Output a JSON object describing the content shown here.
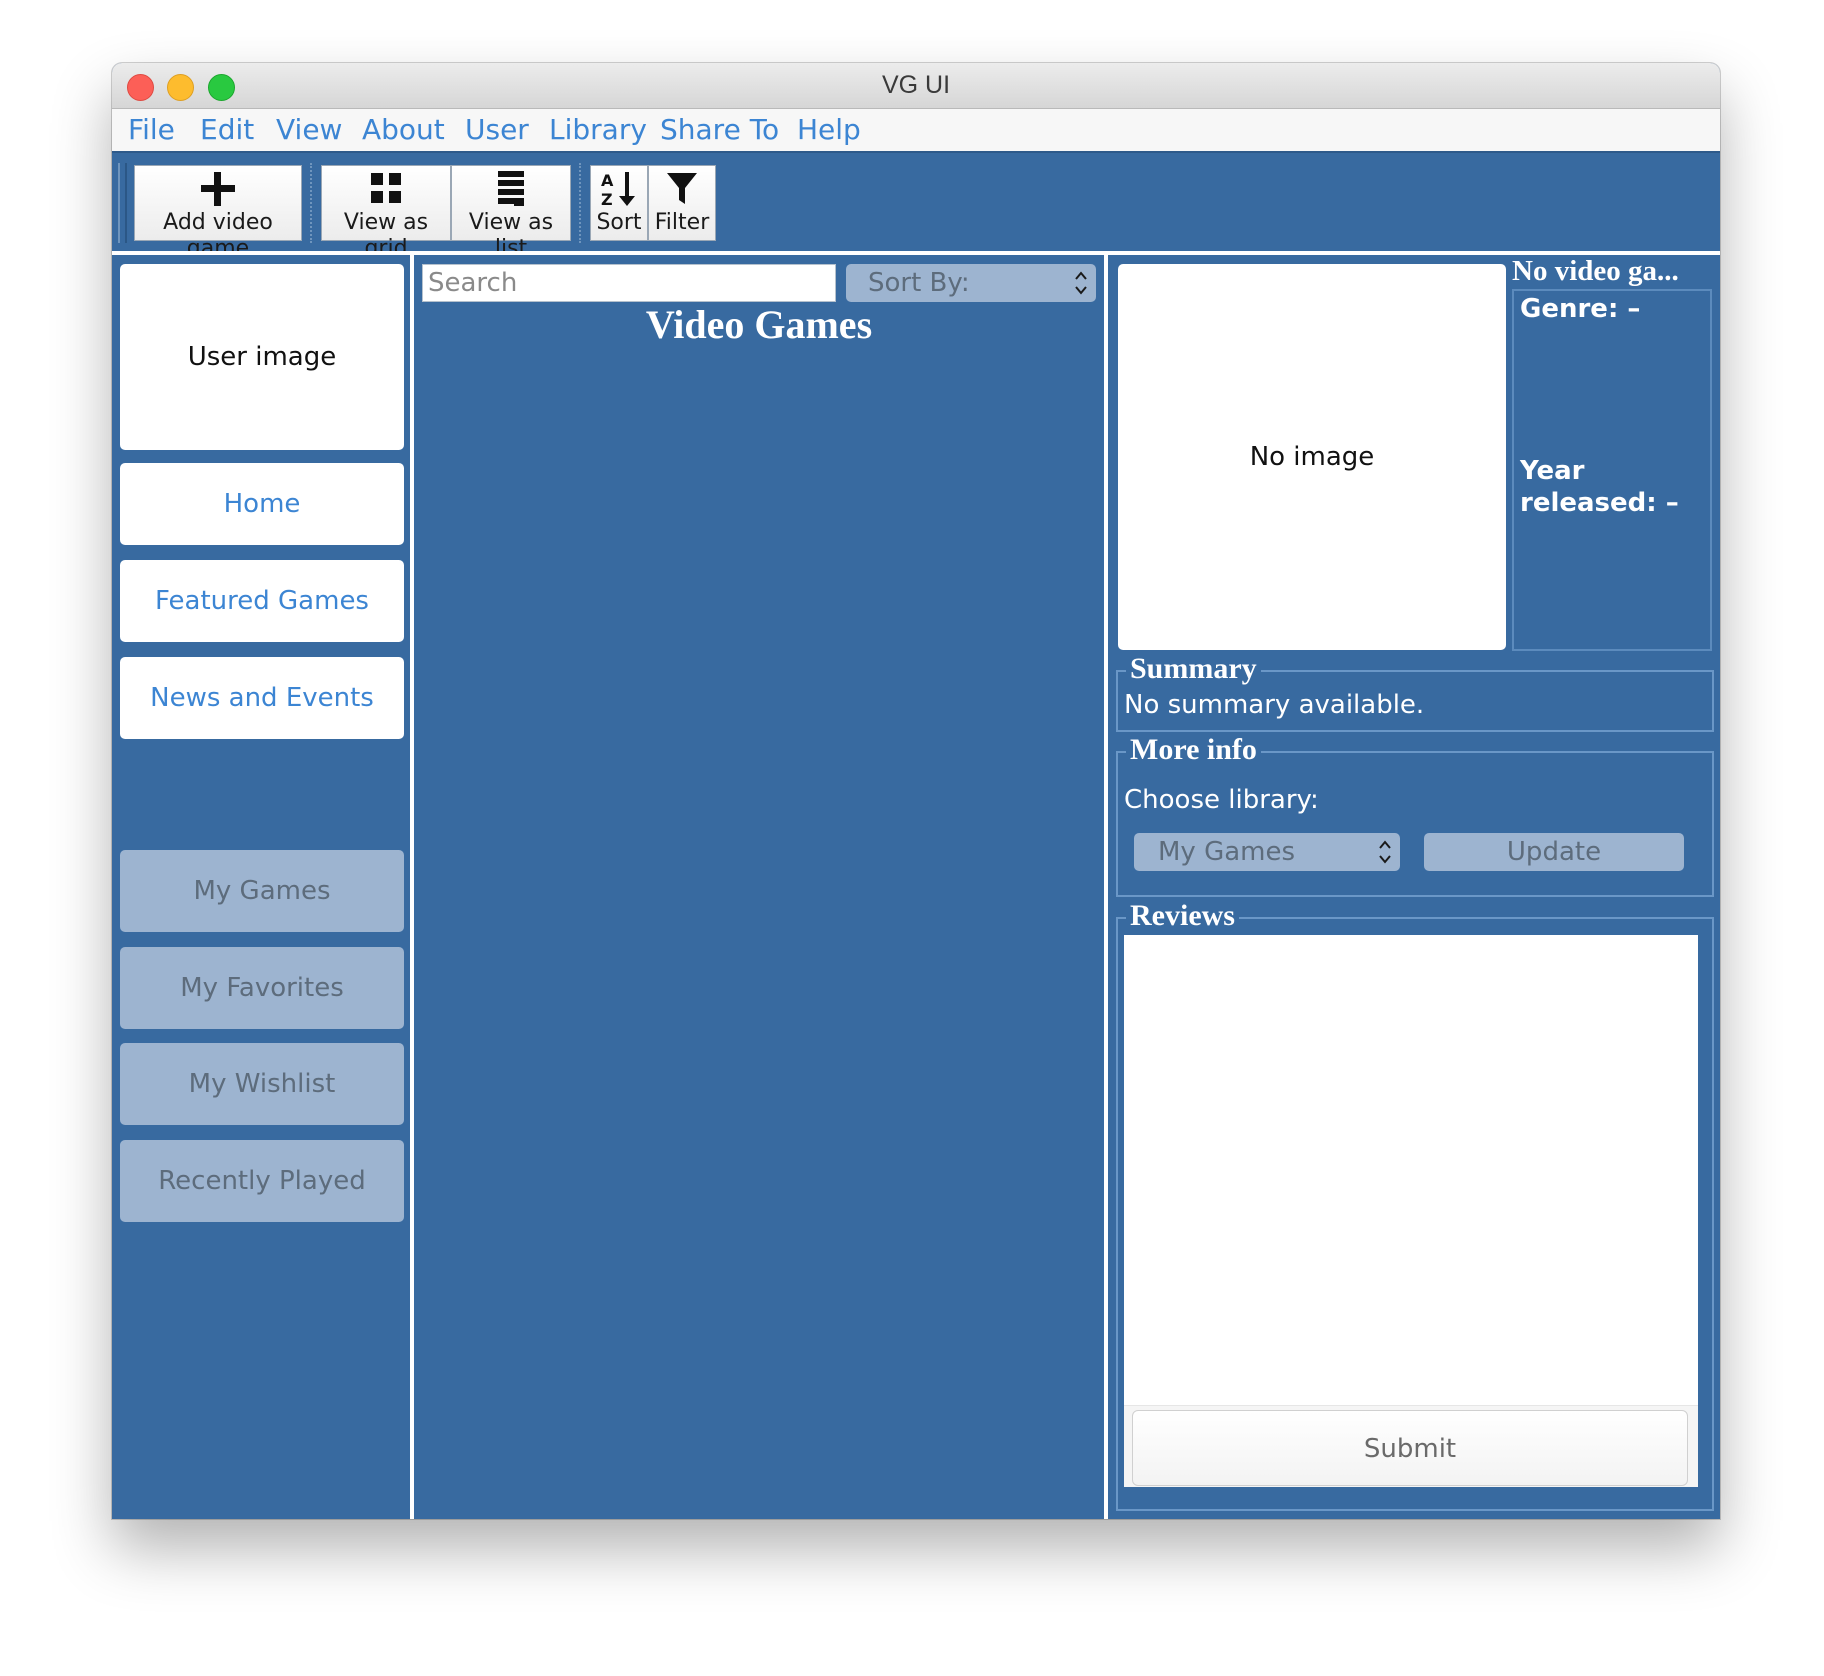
{
  "window": {
    "title": "VG UI"
  },
  "menu": [
    "File",
    "Edit",
    "View",
    "About",
    "User",
    "Library",
    "Share To",
    "Help"
  ],
  "toolbar": {
    "add_label": "Add video game",
    "grid_label": "View as grid",
    "list_label": "View as list",
    "sort_label": "Sort",
    "filter_label": "Filter"
  },
  "sidebar": {
    "user_image": "User image",
    "nav": [
      "Home",
      "Featured Games",
      "News and Events"
    ],
    "library": [
      "My Games",
      "My Favorites",
      "My Wishlist",
      "Recently Played"
    ]
  },
  "center": {
    "search_placeholder": "Search",
    "sort_by": "Sort By:",
    "title": "Video Games"
  },
  "details": {
    "image_placeholder": "No image",
    "game_title": "No video ga...",
    "genre": "Genre: –",
    "year_line1": "Year",
    "year_line2": "released: –",
    "summary_legend": "Summary",
    "summary_text": "No summary available.",
    "moreinfo_legend": "More info",
    "choose_library": "Choose library:",
    "library_selected": "My Games",
    "update_label": "Update",
    "reviews_legend": "Reviews",
    "submit_label": "Submit"
  },
  "colors": {
    "panel_blue": "#386aa0",
    "menu_text": "#3c85d3",
    "disabled_button": "#9db4d0"
  }
}
